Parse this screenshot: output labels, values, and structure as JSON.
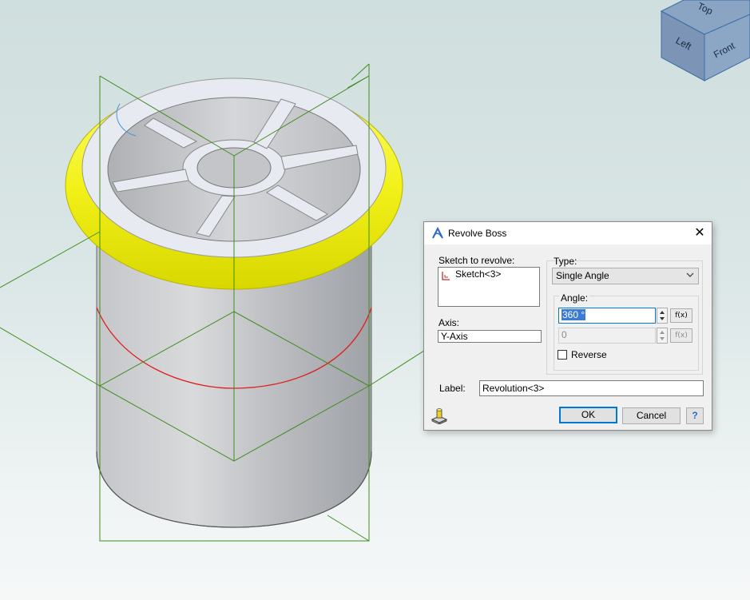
{
  "viewcube": {
    "faces": [
      "Top",
      "Left",
      "Front"
    ]
  },
  "dialog": {
    "title": "Revolve Boss",
    "close_glyph": "✕",
    "sketch_label": "Sketch to revolve:",
    "sketch_items": [
      "Sketch<3>"
    ],
    "axis_label": "Axis:",
    "axis_value": "Y-Axis",
    "type_label": "Type:",
    "type_value": "Single Angle",
    "angle_label": "Angle:",
    "angle1_value": "360 °",
    "angle2_value": "0",
    "fx_label": "f(x)",
    "reverse_label": "Reverse",
    "reverse_checked": false,
    "label_label": "Label:",
    "label_value": "Revolution<3>",
    "ok_label": "OK",
    "cancel_label": "Cancel",
    "help_label": "?"
  },
  "colors": {
    "rim": "#f2f21a",
    "sketch_lines": "#3e8e1e",
    "profile_curve": "#e02020",
    "body": "#c8cacd",
    "accent": "#0078d7"
  }
}
